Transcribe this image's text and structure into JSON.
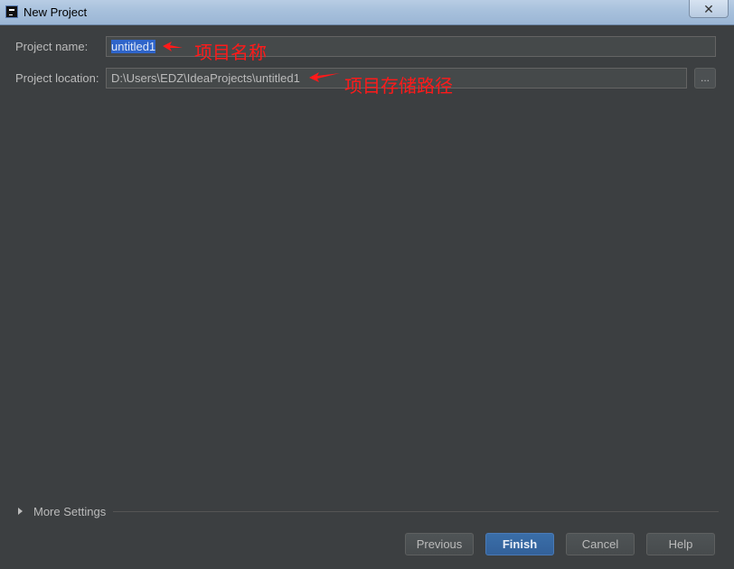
{
  "window": {
    "title": "New Project",
    "close_glyph": "✕"
  },
  "form": {
    "name_label": "Project name:",
    "name_value": "untitled1",
    "location_label": "Project location:",
    "location_value": "D:\\Users\\EDZ\\IdeaProjects\\untitled1",
    "browse_label": "..."
  },
  "annotations": {
    "name_note": "项目名称",
    "location_note": "项目存储路径",
    "color": "#ff1a1a"
  },
  "more_settings": {
    "label": "More Settings"
  },
  "buttons": {
    "previous": "Previous",
    "finish": "Finish",
    "cancel": "Cancel",
    "help": "Help"
  },
  "colors": {
    "background": "#3c3f41",
    "selection": "#2f65ca",
    "primary_button": "#365f9c"
  },
  "icons": [
    "app-icon",
    "close-icon",
    "expand-arrow-icon"
  ]
}
